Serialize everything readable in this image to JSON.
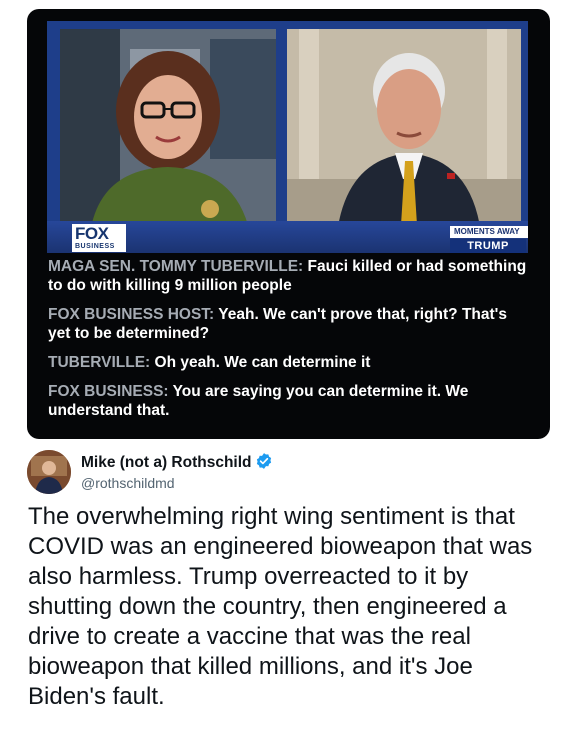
{
  "quoted_media": {
    "chyron": {
      "logo_text": "FOX",
      "logo_subtext": "BUSINESS",
      "moments_away": "MOMENTS AWAY",
      "up_next": "TRUMP"
    },
    "transcript": [
      {
        "speaker": "MAGA SEN. TOMMY TUBERVILLE:",
        "text": "Fauci killed or had something to do with killing 9 million people"
      },
      {
        "speaker": "FOX BUSINESS HOST:",
        "text": "Yeah. We can't prove that, right? That's yet to be determined?"
      },
      {
        "speaker": "TUBERVILLE:",
        "text": "Oh yeah. We can determine it"
      },
      {
        "speaker": "FOX BUSINESS:",
        "text": "You are saying you can determine it. We understand that."
      }
    ]
  },
  "tweet": {
    "display_name": "Mike (not a) Rothschild",
    "handle": "@rothschildmd",
    "verified_icon": "verified-badge-icon",
    "verified_color": "#1d9bf0",
    "text": "The overwhelming right wing sentiment is that COVID was an engineered bioweapon that was also harmless. Trump overreacted to it by shutting down the country, then engineered a drive to create a vaccine that was the real bioweapon that killed millions, and it's Joe Biden's fault."
  }
}
